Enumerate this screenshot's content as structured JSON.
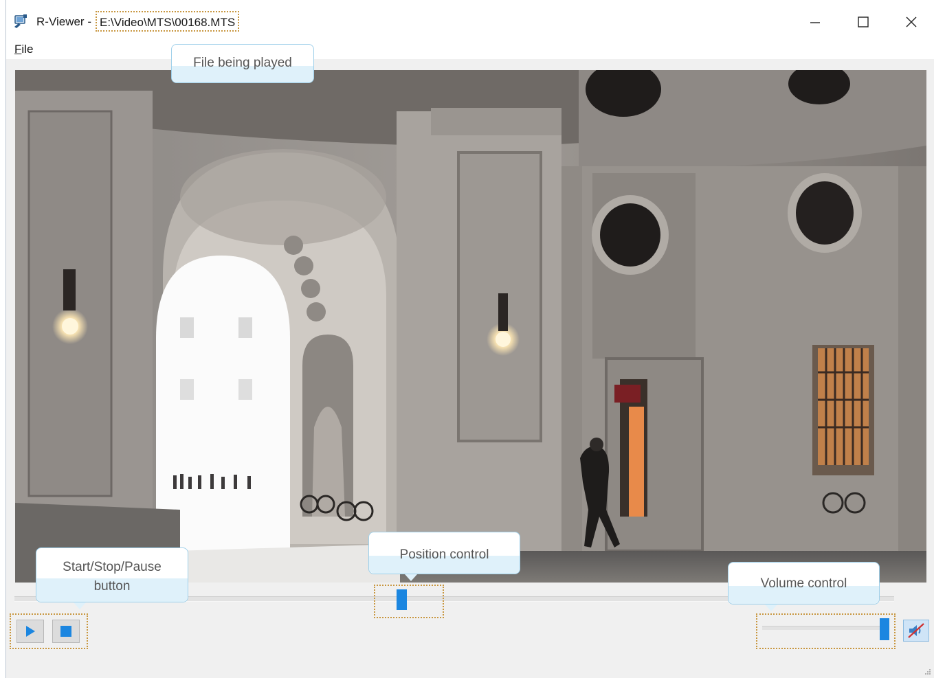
{
  "window": {
    "app_name": "R-Viewer - ",
    "file_path": "E:\\Video\\MTS\\00168.MTS",
    "minimize_icon": "minimize-icon",
    "maximize_icon": "maximize-icon",
    "close_icon": "close-icon"
  },
  "menu": {
    "file_accel": "F",
    "file_rest": "ile"
  },
  "player": {
    "position": 0.44,
    "volume": 1.0,
    "muted": true,
    "play_icon": "play-icon",
    "stop_icon": "stop-icon",
    "mute_icon": "speaker-muted-icon"
  },
  "callouts": {
    "file": "File being played",
    "position": "Position control",
    "startstop_line1": "Start/Stop/Pause",
    "startstop_line2": "button",
    "volume": "Volume control"
  },
  "colors": {
    "accent": "#1b86e0",
    "highlight_border": "#c8963e",
    "callout_fill": "#dff1fa",
    "callout_border": "#9fd0ea"
  }
}
